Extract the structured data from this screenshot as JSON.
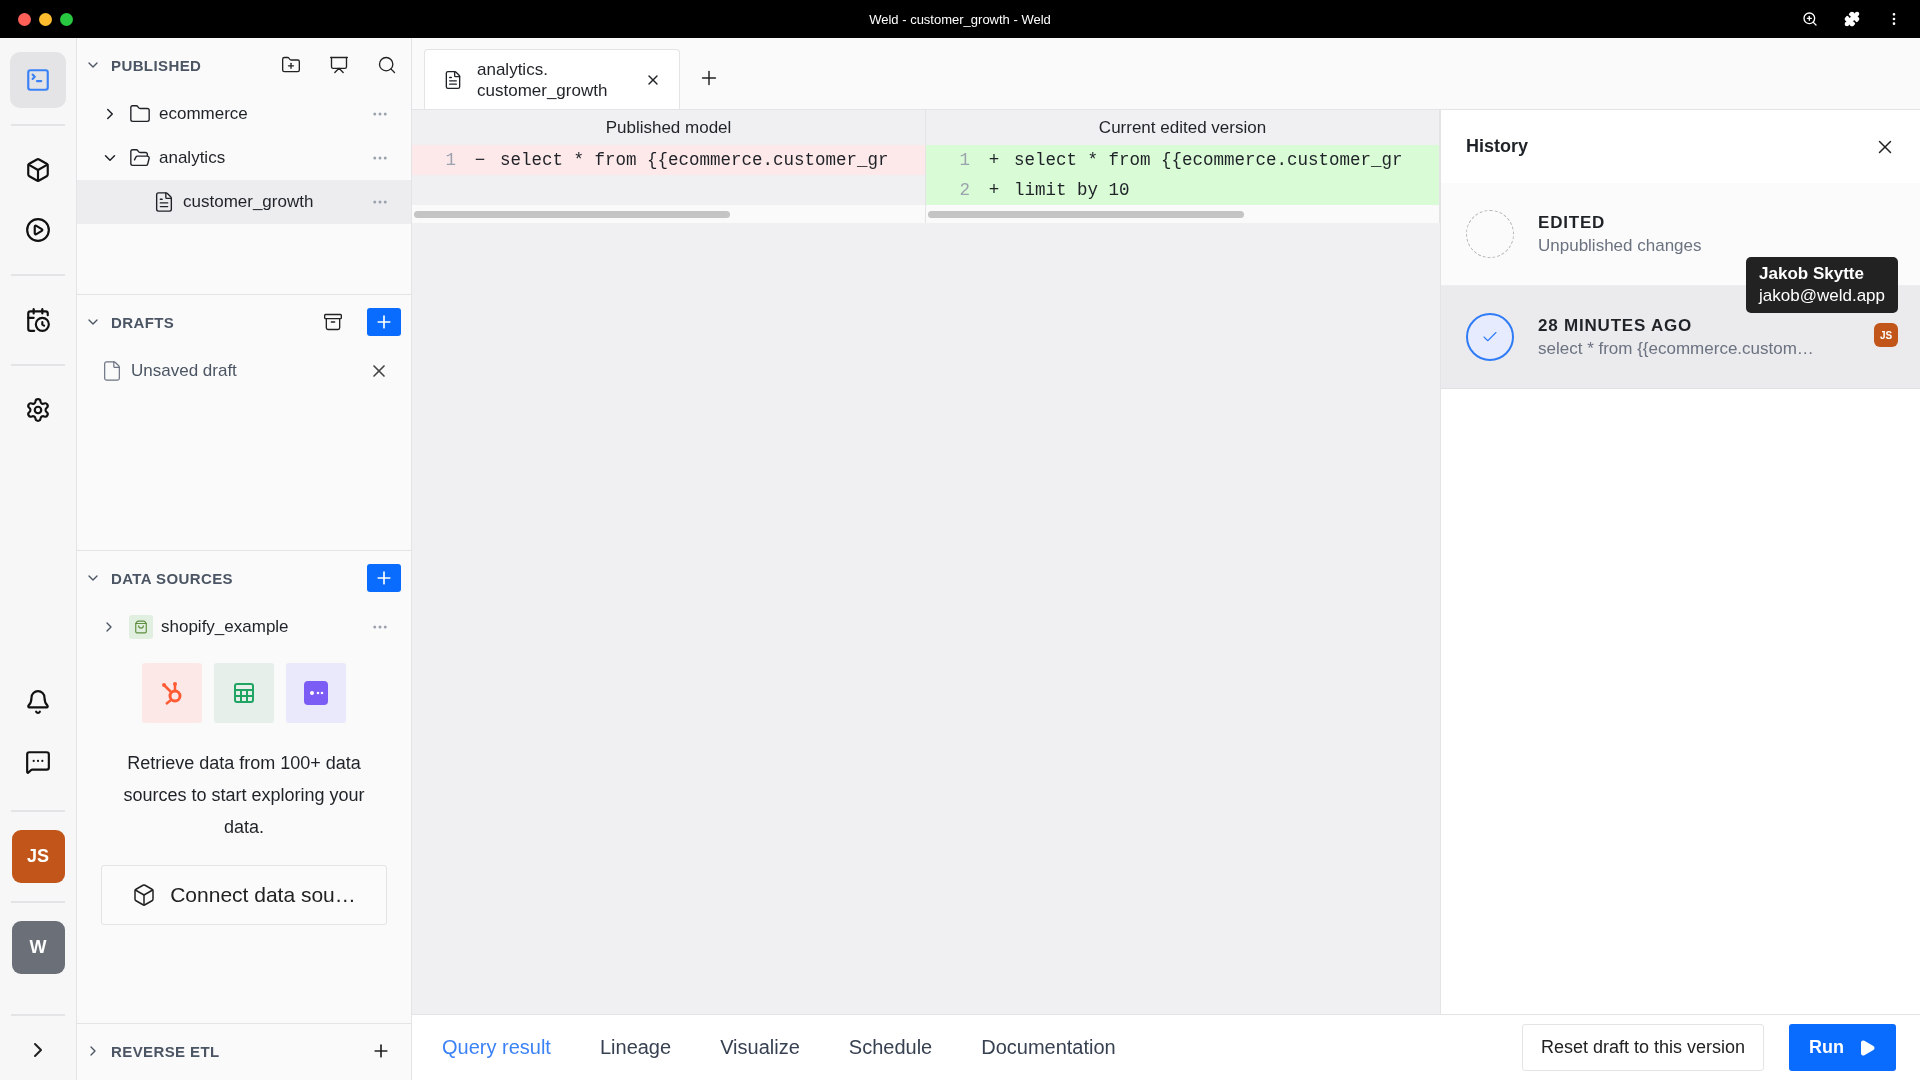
{
  "window": {
    "title": "Weld - customer_growth - Weld"
  },
  "rail": {
    "items": [
      {
        "kind": "editor",
        "selected": true
      },
      {
        "kind": "models",
        "selected": false
      },
      {
        "kind": "orchestration",
        "selected": false
      },
      {
        "kind": "history",
        "selected": false
      },
      {
        "kind": "settings",
        "selected": false
      },
      {
        "kind": "notifications",
        "selected": false
      },
      {
        "kind": "chat",
        "selected": false
      }
    ],
    "user_avatar": "JS",
    "workspace_avatar": "W"
  },
  "published": {
    "title": "PUBLISHED",
    "expanded": true,
    "tree": [
      {
        "label": "ecommerce",
        "kind": "folder",
        "expanded": false,
        "selected": false
      },
      {
        "label": "analytics",
        "kind": "folder",
        "expanded": true,
        "selected": false,
        "children": [
          {
            "label": "customer_growth",
            "kind": "file",
            "selected": true
          }
        ]
      }
    ]
  },
  "drafts": {
    "title": "DRAFTS",
    "expanded": true,
    "items": [
      {
        "label": "Unsaved draft"
      }
    ]
  },
  "data_sources": {
    "title": "DATA SOURCES",
    "expanded": true,
    "items": [
      {
        "label": "shopify_example",
        "expanded": false
      }
    ],
    "connectors": [
      {
        "kind": "sprocket"
      },
      {
        "kind": "sheet"
      },
      {
        "kind": "chat"
      }
    ],
    "promo": "Retrieve data from 100+ data sources to start exploring your data.",
    "connect_button": "Connect data sou…"
  },
  "reverse_etl": {
    "title": "REVERSE ETL",
    "expanded": false
  },
  "editor_tabs": [
    {
      "label_lines": [
        "analytics.",
        "customer_growth"
      ]
    }
  ],
  "diff": {
    "left": {
      "title": "Published model",
      "lines": [
        {
          "number": "1",
          "sign": "−",
          "text": "select * from {{ecommerce.customer_gr",
          "kind": "removed"
        }
      ]
    },
    "right": {
      "title": "Current edited version",
      "lines": [
        {
          "number": "1",
          "sign": "+",
          "text": "select * from {{ecommerce.customer_gr",
          "kind": "added"
        },
        {
          "number": "2",
          "sign": "+",
          "text": "limit by 10",
          "kind": "added"
        }
      ]
    }
  },
  "history": {
    "title": "History",
    "entries": [
      {
        "kind": "edited",
        "title": "EDITED",
        "subtitle": "Unpublished changes",
        "selected": false
      },
      {
        "kind": "version",
        "title": "28 MINUTES AGO",
        "subtitle": "select * from {{ecommerce.custom…",
        "selected": true,
        "avatar": "JS"
      }
    ],
    "tooltip": {
      "name": "Jakob Skytte",
      "email": "jakob@weld.app"
    }
  },
  "bottom_tabs": [
    {
      "label": "Query result",
      "selected": true
    },
    {
      "label": "Lineage",
      "selected": false
    },
    {
      "label": "Visualize",
      "selected": false
    },
    {
      "label": "Schedule",
      "selected": false
    },
    {
      "label": "Documentation",
      "selected": false
    }
  ],
  "reset_button": "Reset draft to this version",
  "run_button": "Run"
}
